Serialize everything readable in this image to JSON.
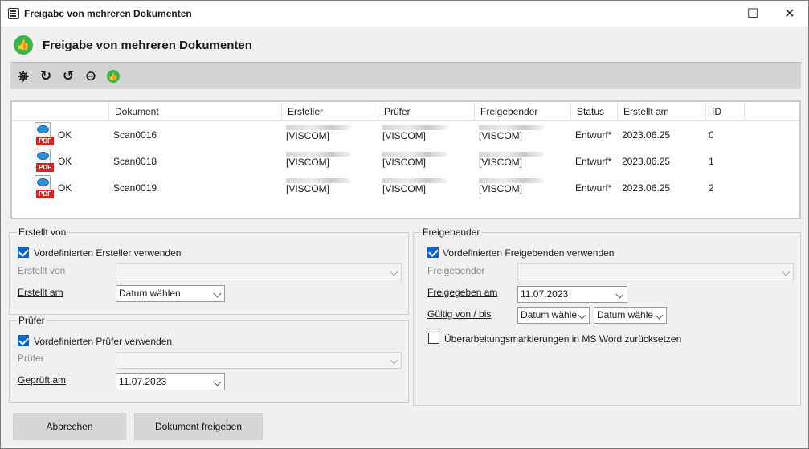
{
  "window": {
    "title": "Freigabe von mehreren Dokumenten"
  },
  "header": {
    "title": "Freigabe von mehreren Dokumenten",
    "icon": "thumbs-up-green-icon"
  },
  "toolbar": {
    "icons": [
      "scan-icon",
      "refresh-icon",
      "reset-icon",
      "remove-icon",
      "approve-icon"
    ]
  },
  "grid": {
    "columns": [
      "Dokument",
      "Ersteller",
      "Prüfer",
      "Freigebender",
      "Status",
      "Erstellt am",
      "ID"
    ],
    "rows": [
      {
        "state": "OK",
        "dokument": "Scan0016",
        "ersteller": "[VISCOM]",
        "pruefer": "[VISCOM]",
        "freigebender": "[VISCOM]",
        "status": "Entwurf*",
        "erstellt": "2023.06.25",
        "id": "0"
      },
      {
        "state": "OK",
        "dokument": "Scan0018",
        "ersteller": "[VISCOM]",
        "pruefer": "[VISCOM]",
        "freigebender": "[VISCOM]",
        "status": "Entwurf*",
        "erstellt": "2023.06.25",
        "id": "1"
      },
      {
        "state": "OK",
        "dokument": "Scan0019",
        "ersteller": "[VISCOM]",
        "pruefer": "[VISCOM]",
        "freigebender": "[VISCOM]",
        "status": "Entwurf*",
        "erstellt": "2023.06.25",
        "id": "2"
      }
    ]
  },
  "erstellt_von": {
    "group_title": "Erstellt von",
    "checkbox_label": "Vordefinierten Ersteller verwenden",
    "field_label": "Erstellt von",
    "date_label": "Erstellt am",
    "date_value": "Datum wählen"
  },
  "pruefer": {
    "group_title": "Prüfer",
    "checkbox_label": "Vordefinierten Prüfer verwenden",
    "field_label": "Prüfer",
    "date_label": "Geprüft am",
    "date_value": "11.07.2023"
  },
  "freigebender": {
    "group_title": "Freigebender",
    "checkbox_label": "Vordefinierten Freigebenden verwenden",
    "field_label": "Freigebender",
    "date_label": "Freigegeben am",
    "date_value": "11.07.2023",
    "valid_label": "Gültig von / bis",
    "valid_from": "Datum wähle",
    "valid_to": "Datum wähle",
    "reset_label": "Überarbeitungsmarkierungen in MS Word zurücksetzen"
  },
  "buttons": {
    "cancel": "Abbrechen",
    "approve": "Dokument freigeben"
  }
}
